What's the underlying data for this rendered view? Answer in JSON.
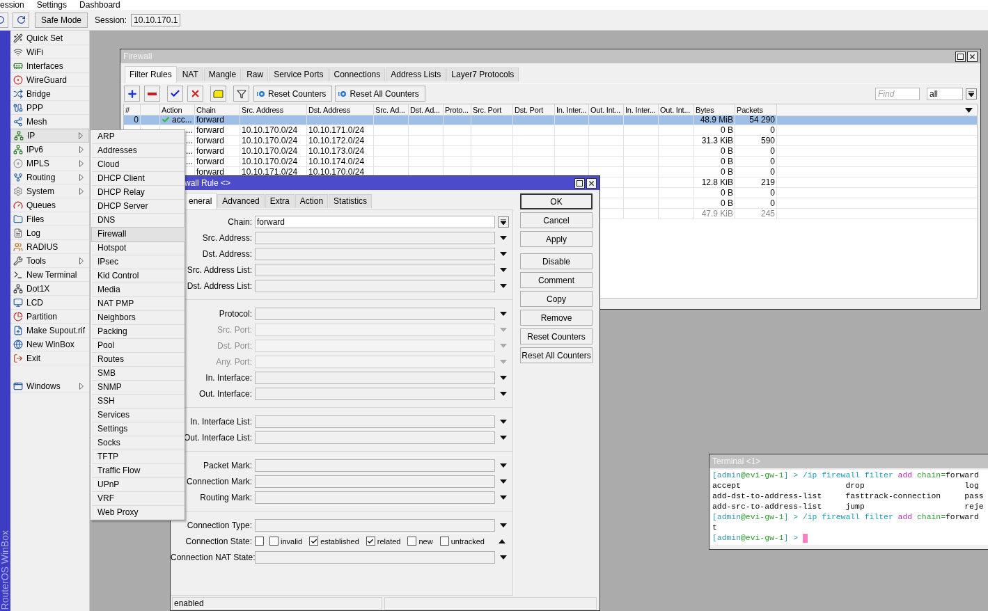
{
  "menu_bar": [
    "ession",
    "Settings",
    "Dashboard"
  ],
  "toolbar": {
    "safe_mode": "Safe Mode",
    "session_label": "Session:",
    "session_value": "10.10.170.1"
  },
  "brand": "RouterOS WinBox",
  "sidebar": {
    "groups": [
      [
        {
          "label": "Quick Set",
          "has_submenu": false,
          "selected": false
        },
        {
          "label": "WiFi",
          "has_submenu": false,
          "selected": false
        },
        {
          "label": "Interfaces",
          "has_submenu": false,
          "selected": false
        },
        {
          "label": "WireGuard",
          "has_submenu": false,
          "selected": false
        },
        {
          "label": "Bridge",
          "has_submenu": false,
          "selected": false
        },
        {
          "label": "PPP",
          "has_submenu": false,
          "selected": false
        },
        {
          "label": "Mesh",
          "has_submenu": false,
          "selected": false
        },
        {
          "label": "IP",
          "has_submenu": true,
          "selected": true
        },
        {
          "label": "IPv6",
          "has_submenu": true,
          "selected": false
        },
        {
          "label": "MPLS",
          "has_submenu": true,
          "selected": false
        },
        {
          "label": "Routing",
          "has_submenu": true,
          "selected": false
        },
        {
          "label": "System",
          "has_submenu": true,
          "selected": false
        },
        {
          "label": "Queues",
          "has_submenu": false,
          "selected": false
        },
        {
          "label": "Files",
          "has_submenu": false,
          "selected": false
        },
        {
          "label": "Log",
          "has_submenu": false,
          "selected": false
        },
        {
          "label": "RADIUS",
          "has_submenu": false,
          "selected": false
        },
        {
          "label": "Tools",
          "has_submenu": true,
          "selected": false
        },
        {
          "label": "New Terminal",
          "has_submenu": false,
          "selected": false
        },
        {
          "label": "Dot1X",
          "has_submenu": false,
          "selected": false
        },
        {
          "label": "LCD",
          "has_submenu": false,
          "selected": false
        },
        {
          "label": "Partition",
          "has_submenu": false,
          "selected": false
        },
        {
          "label": "Make Supout.rif",
          "has_submenu": false,
          "selected": false
        },
        {
          "label": "New WinBox",
          "has_submenu": false,
          "selected": false
        },
        {
          "label": "Exit",
          "has_submenu": false,
          "selected": false
        }
      ],
      [
        {
          "label": "Windows",
          "has_submenu": true,
          "selected": false
        }
      ]
    ]
  },
  "submenu": {
    "items": [
      {
        "label": "ARP",
        "selected": false
      },
      {
        "label": "Addresses",
        "selected": false
      },
      {
        "label": "Cloud",
        "selected": false
      },
      {
        "label": "DHCP Client",
        "selected": false
      },
      {
        "label": "DHCP Relay",
        "selected": false
      },
      {
        "label": "DHCP Server",
        "selected": false
      },
      {
        "label": "DNS",
        "selected": false
      },
      {
        "label": "Firewall",
        "selected": true
      },
      {
        "label": "Hotspot",
        "selected": false
      },
      {
        "label": "IPsec",
        "selected": false
      },
      {
        "label": "Kid Control",
        "selected": false
      },
      {
        "label": "Media",
        "selected": false
      },
      {
        "label": "NAT PMP",
        "selected": false
      },
      {
        "label": "Neighbors",
        "selected": false
      },
      {
        "label": "Packing",
        "selected": false
      },
      {
        "label": "Pool",
        "selected": false
      },
      {
        "label": "Routes",
        "selected": false
      },
      {
        "label": "SMB",
        "selected": false
      },
      {
        "label": "SNMP",
        "selected": false
      },
      {
        "label": "SSH",
        "selected": false
      },
      {
        "label": "Services",
        "selected": false
      },
      {
        "label": "Settings",
        "selected": false
      },
      {
        "label": "Socks",
        "selected": false
      },
      {
        "label": "TFTP",
        "selected": false
      },
      {
        "label": "Traffic Flow",
        "selected": false
      },
      {
        "label": "UPnP",
        "selected": false
      },
      {
        "label": "VRF",
        "selected": false
      },
      {
        "label": "Web Proxy",
        "selected": false
      }
    ]
  },
  "firewall": {
    "title": "Firewall",
    "tabs": [
      {
        "label": "Filter Rules",
        "selected": true
      },
      {
        "label": "NAT",
        "selected": false
      },
      {
        "label": "Mangle",
        "selected": false
      },
      {
        "label": "Raw",
        "selected": false
      },
      {
        "label": "Service Ports",
        "selected": false
      },
      {
        "label": "Connections",
        "selected": false
      },
      {
        "label": "Address Lists",
        "selected": false
      },
      {
        "label": "Layer7 Protocols",
        "selected": false
      }
    ],
    "toolbar_buttons": [
      "Reset Counters",
      "Reset All Counters"
    ],
    "find": {
      "placeholder": "Find"
    },
    "filter_value": "all",
    "table": {
      "columns": [
        {
          "label": "#"
        },
        {},
        {
          "label": "Action"
        },
        {
          "label": "Chain"
        },
        {
          "label": "Src. Address"
        },
        {
          "label": "Dst. Address"
        },
        {
          "label": "Src. Ad..."
        },
        {
          "label": "Dst. Ad..."
        },
        {
          "label": "Proto..."
        },
        {
          "label": "Src. Port"
        },
        {
          "label": "Dst. Port"
        },
        {
          "label": "In. Inter..."
        },
        {
          "label": "Out. Int..."
        },
        {
          "label": "In. Inter..."
        },
        {
          "label": "Out. Int..."
        },
        {
          "label": "Bytes"
        },
        {
          "label": "Packets"
        }
      ],
      "rows": [
        {
          "number": "0",
          "action": "acc...",
          "accepted": true,
          "chain": "forward",
          "bytes": "48.9 MiB",
          "packets": "54 290",
          "selected": true,
          "disabled": false
        },
        {
          "action": "...",
          "chain": "forward",
          "src_address": "10.10.170.0/24",
          "dst_address": "10.10.171.0/24",
          "bytes": "0 B",
          "packets": "0",
          "selected": false,
          "disabled": false
        },
        {
          "action": "...",
          "chain": "forward",
          "src_address": "10.10.170.0/24",
          "dst_address": "10.10.172.0/24",
          "bytes": "31.3 KiB",
          "packets": "590",
          "selected": false,
          "disabled": false
        },
        {
          "action": "...",
          "chain": "forward",
          "src_address": "10.10.170.0/24",
          "dst_address": "10.10.173.0/24",
          "bytes": "0 B",
          "packets": "0",
          "selected": false,
          "disabled": false
        },
        {
          "action": "...",
          "chain": "forward",
          "src_address": "10.10.170.0/24",
          "dst_address": "10.10.174.0/24",
          "bytes": "0 B",
          "packets": "0",
          "selected": false,
          "disabled": false
        },
        {
          "chain": "forward",
          "src_address": "10.10.171.0/24",
          "dst_address": "10.10.170.0/24",
          "bytes": "0 B",
          "packets": "0",
          "selected": false,
          "disabled": false
        },
        {
          "bytes": "12.8 KiB",
          "packets": "219",
          "selected": false,
          "disabled": false
        },
        {
          "bytes": "0 B",
          "packets": "0",
          "selected": false,
          "disabled": false
        },
        {
          "bytes": "0 B",
          "packets": "0",
          "selected": false,
          "disabled": false
        },
        {
          "bytes": "47.9 KiB",
          "packets": "245",
          "selected": false,
          "disabled": true
        }
      ]
    }
  },
  "rule_dialog": {
    "title": "wall Rule <>",
    "tabs": [
      {
        "label": "eneral",
        "selected": true
      },
      {
        "label": "Advanced",
        "selected": false
      },
      {
        "label": "Extra",
        "selected": false
      },
      {
        "label": "Action",
        "selected": false
      },
      {
        "label": "Statistics",
        "selected": false
      }
    ],
    "groups": [
      [
        {
          "label": "Chain:",
          "kind": "select",
          "value": "forward",
          "disabled": false
        },
        {
          "label": "Src. Address:",
          "kind": "combo",
          "disabled": false
        },
        {
          "label": "Dst. Address:",
          "kind": "combo",
          "disabled": false
        },
        {
          "label": "Src. Address List:",
          "kind": "combo",
          "disabled": false
        },
        {
          "label": "Dst. Address List:",
          "kind": "combo",
          "disabled": false
        }
      ],
      [
        {
          "label": "Protocol:",
          "kind": "combo",
          "disabled": false
        },
        {
          "label": "Src. Port:",
          "kind": "combo",
          "disabled": true
        },
        {
          "label": "Dst. Port:",
          "kind": "combo",
          "disabled": true
        },
        {
          "label": "Any. Port:",
          "kind": "combo",
          "disabled": true
        },
        {
          "label": "In. Interface:",
          "kind": "combo",
          "disabled": false
        },
        {
          "label": "Out. Interface:",
          "kind": "combo",
          "disabled": false
        }
      ],
      [
        {
          "label": "In. Interface List:",
          "kind": "combo",
          "disabled": false
        },
        {
          "label": "Out. Interface List:",
          "kind": "combo",
          "disabled": false
        }
      ],
      [
        {
          "label": "Packet Mark:",
          "kind": "combo",
          "disabled": false
        },
        {
          "label": "Connection Mark:",
          "kind": "combo",
          "disabled": false
        },
        {
          "label": "Routing Mark:",
          "kind": "combo",
          "disabled": false
        }
      ],
      [
        {
          "label": "Connection Type:",
          "kind": "combo",
          "disabled": false
        },
        {
          "label": "Connection State:",
          "kind": "checks",
          "disabled": false,
          "expanded": true,
          "options": [
            {
              "checked": false
            },
            {
              "label": "invalid",
              "checked": false
            },
            {
              "label": "established",
              "checked": true
            },
            {
              "label": "related",
              "checked": true
            },
            {
              "label": "new",
              "checked": false
            },
            {
              "label": "untracked",
              "checked": false
            }
          ]
        },
        {
          "label": "Connection NAT State:",
          "kind": "combo",
          "disabled": false
        }
      ]
    ],
    "button_groups": [
      [
        {
          "label": "OK",
          "default": true
        },
        {
          "label": "Cancel",
          "default": false
        },
        {
          "label": "Apply",
          "default": false
        }
      ],
      [
        {
          "label": "Disable",
          "default": false
        },
        {
          "label": "Comment",
          "default": false
        },
        {
          "label": "Copy",
          "default": false
        },
        {
          "label": "Remove",
          "default": false
        },
        {
          "label": "Reset Counters",
          "default": false
        },
        {
          "label": "Reset All Counters",
          "default": false
        }
      ]
    ],
    "status_bar": {
      "text": "enabled"
    }
  },
  "terminal": {
    "title": "Terminal <1>",
    "lines": [
      {
        "cursor": false,
        "segments": [
          {
            "text": "[admin",
            "kind": "prompt"
          },
          {
            "text": "@evi-gw-1",
            "kind": "host"
          },
          {
            "text": "] > ",
            "kind": "prompt"
          },
          {
            "text": "/ip firewall filter ",
            "kind": "path"
          },
          {
            "text": "add",
            "kind": "verb"
          },
          {
            "text": " chain=",
            "kind": "param"
          },
          {
            "text": "forward",
            "kind": "plain"
          }
        ]
      },
      {
        "cursor": false,
        "segments": [
          {
            "text": "accept                      drop                     log",
            "kind": "plain"
          }
        ]
      },
      {
        "cursor": false,
        "segments": [
          {
            "text": "add-dst-to-address-list     fasttrack-connection     pass",
            "kind": "plain"
          }
        ]
      },
      {
        "cursor": false,
        "segments": [
          {
            "text": "add-src-to-address-list     jump                     reje",
            "kind": "plain"
          }
        ]
      },
      {
        "cursor": false,
        "segments": [
          {
            "text": "[admin",
            "kind": "prompt"
          },
          {
            "text": "@evi-gw-1",
            "kind": "host"
          },
          {
            "text": "] > ",
            "kind": "prompt"
          },
          {
            "text": "/ip firewall filter ",
            "kind": "path"
          },
          {
            "text": "add",
            "kind": "verb"
          },
          {
            "text": " chain=",
            "kind": "param"
          },
          {
            "text": "forward",
            "kind": "plain"
          }
        ]
      },
      {
        "cursor": false,
        "segments": [
          {
            "text": "t",
            "kind": "plain"
          }
        ]
      },
      {
        "cursor": true,
        "segments": [
          {
            "text": "[admin",
            "kind": "prompt"
          },
          {
            "text": "@evi-gw-1",
            "kind": "host"
          },
          {
            "text": "] > ",
            "kind": "prompt"
          }
        ]
      }
    ]
  }
}
